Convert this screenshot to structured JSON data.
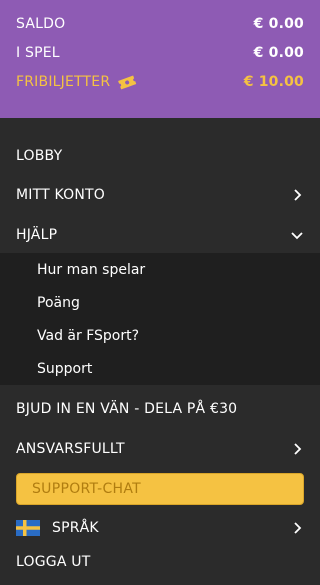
{
  "balance": {
    "saldo_label": "SALDO",
    "saldo_value": "€ 0.00",
    "ispel_label": "I SPEL",
    "ispel_value": "€ 0.00",
    "free_label": "FRIBILJETTER",
    "free_value": "€ 10.00",
    "free_icon": "ticket-icon"
  },
  "menu": {
    "lobby": "LOBBY",
    "account": "MITT KONTO",
    "help": "HJÄLP",
    "help_items": [
      "Hur man spelar",
      "Poäng",
      "Vad är FSport?",
      "Support"
    ],
    "invite": "BJUD IN EN VÄN - DELA PÅ €30",
    "responsible": "ANSVARSFULLT",
    "support_chat": "SUPPORT-CHAT",
    "language": "SPRÅK",
    "language_flag": "sweden-flag-icon",
    "logout": "LOGGA UT"
  },
  "colors": {
    "panel_purple": "#8e5bb4",
    "accent_yellow": "#f5c242",
    "menu_bg": "#2b2b2b",
    "submenu_bg": "#1f1f1f"
  }
}
